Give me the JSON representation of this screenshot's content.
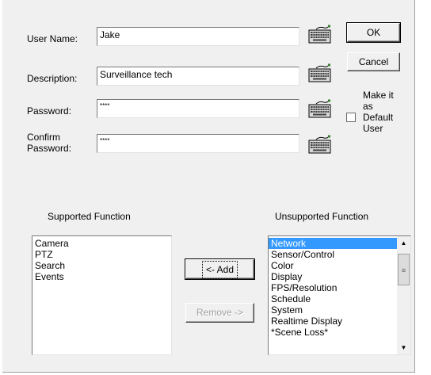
{
  "form": {
    "username_label": "User Name:",
    "username_value": "Jake",
    "description_label": "Description:",
    "description_value": "Surveillance tech",
    "password_label": "Password:",
    "password_value": "****",
    "confirm_label_line1": "Confirm",
    "confirm_label_line2": "Password:",
    "confirm_value": "****"
  },
  "buttons": {
    "ok": "OK",
    "cancel": "Cancel",
    "add": "<- Add",
    "remove": "Remove ->"
  },
  "default_user": {
    "line1": "Make it",
    "line2": "as",
    "line3": "Default",
    "line4": "User",
    "checked": false
  },
  "supported": {
    "title": "Supported Function",
    "items": [
      "Camera",
      "PTZ",
      "Search",
      "Events"
    ]
  },
  "unsupported": {
    "title": "Unsupported Function",
    "items": [
      "Network",
      "Sensor/Control",
      "Color",
      "Display",
      "FPS/Resolution",
      "Schedule",
      "System",
      "Realtime Display",
      "*Scene Loss*"
    ],
    "selected": "Network"
  },
  "icons": {
    "keyboard": "keyboard-icon",
    "scroll_up": "scroll-up-arrow-icon",
    "scroll_down": "scroll-down-arrow-icon",
    "grip": "scroll-thumb-grip-icon"
  },
  "colors": {
    "dialog_bg": "#f0f0f0",
    "selection": "#3399ff"
  }
}
